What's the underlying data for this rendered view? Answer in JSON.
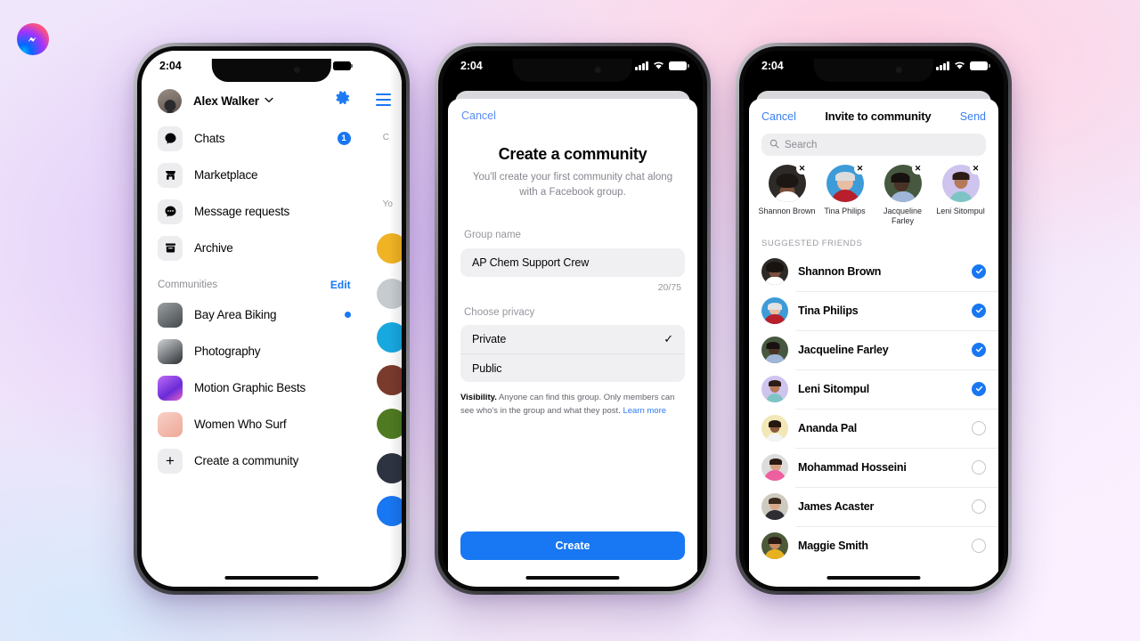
{
  "brand": {
    "logo_name": "messenger-logo",
    "accent": "#1877f2"
  },
  "status_bar": {
    "time": "2:04",
    "signal_icon": "cellular-bars-icon",
    "wifi_icon": "wifi-icon",
    "battery_icon": "battery-icon"
  },
  "phone1": {
    "profile": {
      "name": "Alex Walker",
      "chevron": "⌄",
      "settings_icon": "gear-icon"
    },
    "nav_items": [
      {
        "label": "Chats",
        "icon": "chat-bubble-icon",
        "badge": "1"
      },
      {
        "label": "Marketplace",
        "icon": "storefront-icon",
        "badge": ""
      },
      {
        "label": "Message requests",
        "icon": "message-dots-icon",
        "badge": ""
      },
      {
        "label": "Archive",
        "icon": "archive-box-icon",
        "badge": ""
      }
    ],
    "communities_section": {
      "title": "Communities",
      "edit_label": "Edit"
    },
    "communities": [
      {
        "name": "Bay Area Biking",
        "unread": true,
        "color_a": "#9ba0a3",
        "color_b": "#43484c"
      },
      {
        "name": "Photography",
        "unread": false,
        "color_a": "#cfd3d6",
        "color_b": "#2c3034"
      },
      {
        "name": "Motion Graphic Bests",
        "unread": false,
        "color_a": "#c06cf5",
        "color_b": "#6a2bd8"
      },
      {
        "name": "Women Who Surf",
        "unread": false,
        "color_a": "#f9cfc6",
        "color_b": "#eda898"
      }
    ],
    "create_community": {
      "label": "Create a community",
      "icon": "plus-icon"
    },
    "behind_panel": {
      "menu_icon": "hamburger-icon",
      "partial_label_1": "C",
      "partial_label_2": "Yo"
    }
  },
  "phone2": {
    "cancel_label": "Cancel",
    "title": "Create a community",
    "subtitle": "You'll create your first community chat along with a Facebook group.",
    "group_name_label": "Group name",
    "group_name_value": "AP Chem Support Crew",
    "char_count": "20/75",
    "privacy_label": "Choose privacy",
    "privacy_options": [
      {
        "label": "Private",
        "selected": true,
        "check_icon": "checkmark-icon"
      },
      {
        "label": "Public",
        "selected": false,
        "check_icon": ""
      }
    ],
    "visibility_bold": "Visibility.",
    "visibility_text": " Anyone can find this group. Only members can see who's in the group and what they post. ",
    "visibility_link": "Learn more",
    "create_button": "Create"
  },
  "phone3": {
    "cancel_label": "Cancel",
    "title": "Invite to community",
    "send_label": "Send",
    "search_placeholder": "Search",
    "search_icon": "search-icon",
    "selected_chips": [
      {
        "name": "Shannon Brown",
        "remove_icon": "close-x-icon",
        "bg": "#2d2a28",
        "skin": "#7a4f3c",
        "top": "#ffffff",
        "hair": "#1d1713"
      },
      {
        "name": "Tina Philips",
        "remove_icon": "close-x-icon",
        "bg": "#3d9bd8",
        "skin": "#e8bda4",
        "top": "#b81f2a",
        "hair": "#dcdcdc"
      },
      {
        "name": "Jacqueline Farley",
        "remove_icon": "close-x-icon",
        "bg": "#46583f",
        "skin": "#4a3326",
        "top": "#9fb6d8",
        "hair": "#17120f"
      },
      {
        "name": "Leni Sitompul",
        "remove_icon": "close-x-icon",
        "bg": "#cfc4ee",
        "skin": "#b5795a",
        "top": "#7fc4c4",
        "hair": "#2b1d16"
      }
    ],
    "suggested_title": "SUGGESTED FRIENDS",
    "suggested": [
      {
        "name": "Shannon Brown",
        "selected": true,
        "bg": "#2d2a28",
        "skin": "#7a4f3c",
        "top": "#ffffff",
        "hair": "#191310"
      },
      {
        "name": "Tina Philips",
        "selected": true,
        "bg": "#3d9bd8",
        "skin": "#e8bda4",
        "top": "#b81f2a",
        "hair": "#e2e2e2"
      },
      {
        "name": "Jacqueline Farley",
        "selected": true,
        "bg": "#46583f",
        "skin": "#4a3326",
        "top": "#9fb6d8",
        "hair": "#17120f"
      },
      {
        "name": "Leni Sitompul",
        "selected": true,
        "bg": "#cfc4ee",
        "skin": "#b5795a",
        "top": "#7fc4c4",
        "hair": "#2b1d16"
      },
      {
        "name": "Ananda Pal",
        "selected": false,
        "bg": "#f2e7b6",
        "skin": "#8a5a3c",
        "top": "#f4f4f4",
        "hair": "#241710"
      },
      {
        "name": "Mohammad Hosseini",
        "selected": false,
        "bg": "#dcdcdc",
        "skin": "#d8a183",
        "top": "#ee5fa0",
        "hair": "#2a1a12"
      },
      {
        "name": "James Acaster",
        "selected": false,
        "bg": "#cfcac0",
        "skin": "#d9a98a",
        "top": "#2e2e32",
        "hair": "#3b2a1e"
      },
      {
        "name": "Maggie Smith",
        "selected": false,
        "bg": "#4c5a3a",
        "skin": "#c98a62",
        "top": "#e8b11f",
        "hair": "#2a1a12"
      }
    ],
    "select_icon": "checkmark-circle-icon"
  }
}
